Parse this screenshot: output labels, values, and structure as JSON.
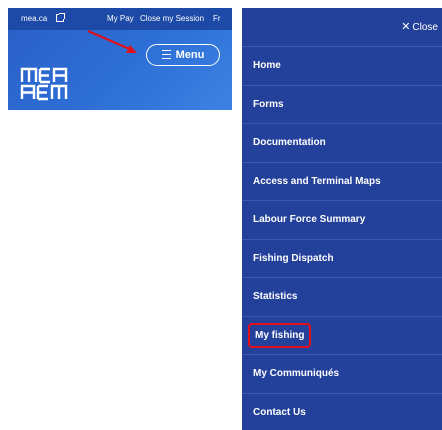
{
  "header": {
    "site_link": "mea.ca",
    "links": [
      "My Pay",
      "Close my Session",
      "Fr"
    ],
    "menu_button_label": "Menu",
    "logo_alt": "MEA AEM"
  },
  "panel": {
    "close_label": "Close",
    "items": [
      {
        "label": "Home"
      },
      {
        "label": "Forms"
      },
      {
        "label": "Documentation"
      },
      {
        "label": "Access and Terminal Maps"
      },
      {
        "label": "Labour Force Summary"
      },
      {
        "label": "Fishing Dispatch"
      },
      {
        "label": "Statistics"
      },
      {
        "label": "My fishing",
        "highlighted": true
      },
      {
        "label": "My Communiqués"
      },
      {
        "label": "Contact Us"
      }
    ]
  },
  "colors": {
    "header_blue": "#2d6fd6",
    "topbar_blue": "#1d4aa7",
    "panel_blue": "#23409b",
    "highlight_red": "#e0101a"
  }
}
